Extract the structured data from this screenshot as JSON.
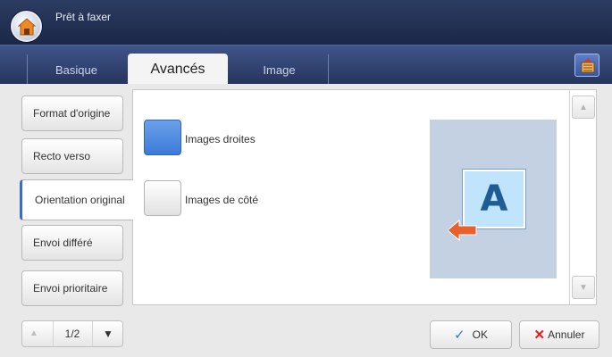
{
  "header": {
    "title": "Prêt à faxer",
    "home_icon": "home-icon"
  },
  "tabs": [
    {
      "label": "Basique",
      "active": false
    },
    {
      "label": "Avancés",
      "active": true
    },
    {
      "label": "Image",
      "active": false
    }
  ],
  "tab_tool_icon": "job-list-icon",
  "sidebar": {
    "items": [
      {
        "label": "Format d'origine",
        "active": false
      },
      {
        "label": "Recto verso",
        "active": false
      },
      {
        "label": "Orientation original",
        "active": true
      },
      {
        "label": "Envoi différé",
        "active": false
      },
      {
        "label": "Envoi prioritaire",
        "active": false
      }
    ]
  },
  "options": [
    {
      "label": "Images droites",
      "selected": true
    },
    {
      "label": "Images de côté",
      "selected": false
    }
  ],
  "preview": {
    "letter": "A"
  },
  "pager": {
    "page": "1/2"
  },
  "actions": {
    "ok_label": "OK",
    "cancel_label": "Annuler"
  },
  "colors": {
    "accent": "#3d7ad8",
    "header": "#1b2747",
    "cancel_x": "#e02020",
    "ok_check": "#3a78d4",
    "arrow": "#e8602c"
  }
}
